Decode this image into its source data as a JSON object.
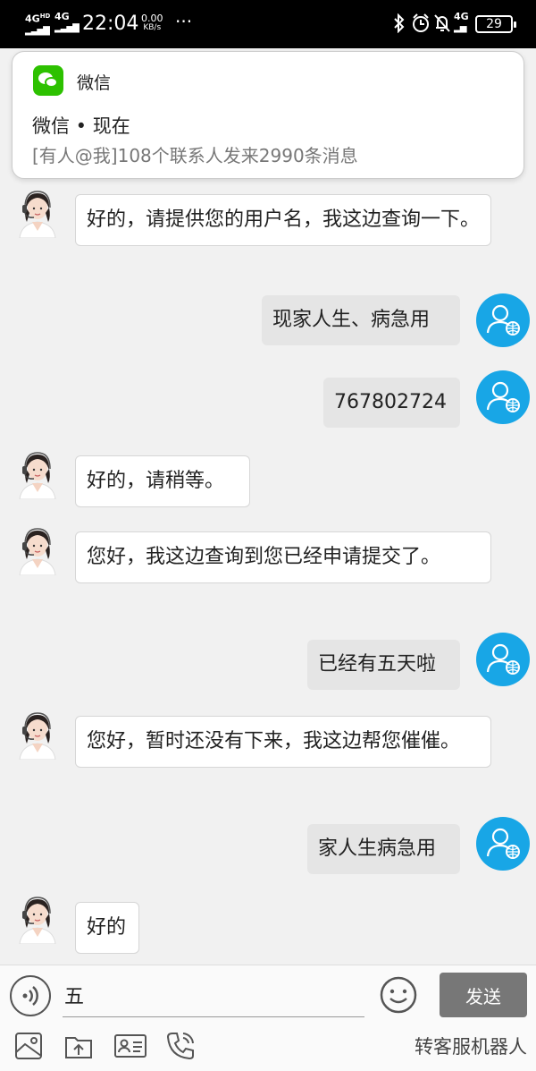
{
  "status_bar": {
    "net1": "4G",
    "net1_sup": "HD",
    "net2": "4G",
    "time": "22:04",
    "speed_value": "0.00",
    "speed_unit": "KB/s",
    "more": "···",
    "net3": "4G",
    "battery": "29"
  },
  "notification": {
    "app_name": "微信",
    "title": "微信 • 现在",
    "body": "[有人@我]108个联系人发来2990条消息"
  },
  "messages": [
    {
      "side": "agent",
      "text": "好的，请提供您的用户名，我这边查询一下。"
    },
    {
      "side": "user",
      "text": "现家人生、病急用"
    },
    {
      "side": "user",
      "text": "767802724"
    },
    {
      "side": "agent",
      "text": "好的，请稍等。"
    },
    {
      "side": "agent",
      "text": "您好，我这边查询到您已经申请提交了。"
    },
    {
      "side": "user",
      "text": "已经有五天啦"
    },
    {
      "side": "agent",
      "text": "您好，暂时还没有下来，我这边帮您催催。"
    },
    {
      "side": "user",
      "text": "家人生病急用"
    },
    {
      "side": "agent",
      "text": "好的"
    }
  ],
  "input": {
    "value": "五",
    "send_label": "发送"
  },
  "toolbar": {
    "icons": [
      "image-icon",
      "file-upload-icon",
      "id-card-icon",
      "phone-icon"
    ],
    "transfer_label": "转客服机器人"
  },
  "colors": {
    "user_avatar": "#18a6e6",
    "wechat_green": "#2dc100",
    "send_button": "#777777"
  }
}
